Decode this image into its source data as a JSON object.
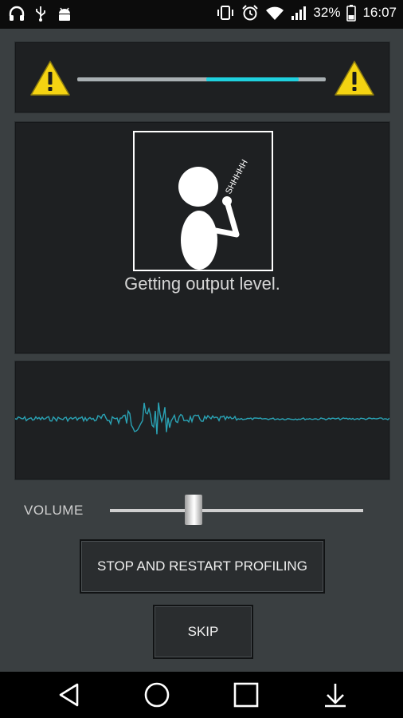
{
  "status_bar": {
    "battery_percent": "32%",
    "time": "16:07",
    "left_icons": [
      "headphones-icon",
      "usb-icon",
      "android-icon"
    ],
    "right_icons": [
      "vibrate-icon",
      "alarm-icon",
      "wifi-icon",
      "signal-icon",
      "battery-icon"
    ]
  },
  "warning_panel": {
    "left_icon": "warning-icon",
    "right_icon": "warning-icon",
    "level_bar": {
      "fill_start_fraction": 0.52,
      "fill_end_fraction": 0.89
    },
    "colors": {
      "track": "#a9b0b3",
      "fill": "#1fd1df"
    }
  },
  "figure_panel": {
    "figure_icon": "shhh-figure-icon",
    "figure_text": "SHHHHH",
    "status_message": "Getting output level."
  },
  "waveform": {
    "color": "#2aa3b5"
  },
  "volume": {
    "label": "VOLUME",
    "value_fraction": 0.33
  },
  "buttons": {
    "restart_label": "STOP AND RESTART PROFILING",
    "skip_label": "SKIP"
  },
  "nav_bar": {
    "items": [
      "back-icon",
      "home-icon",
      "recents-icon",
      "notifications-pull-icon"
    ]
  }
}
